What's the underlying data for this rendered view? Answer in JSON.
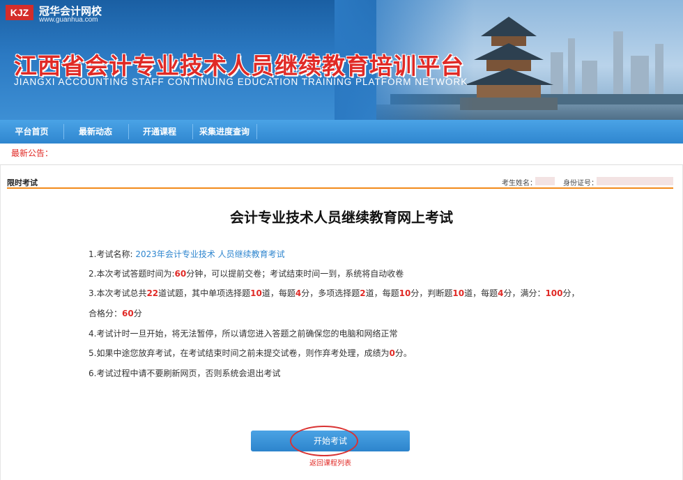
{
  "header": {
    "logo_mark": "KJZ",
    "logo_name": "冠华会计网校",
    "logo_url": "www.guanhua.com",
    "title_cn": "江西省会计专业技术人员继续教育培训平台",
    "title_en": "JIANGXI ACCOUNTING STAFF CONTINUING EDUCATION TRAINING PLATFORM NETWORK"
  },
  "nav": {
    "items": [
      {
        "label": "平台首页"
      },
      {
        "label": "最新动态"
      },
      {
        "label": "开通课程"
      },
      {
        "label": "采集进度查询"
      }
    ]
  },
  "notice": {
    "label": "最新公告："
  },
  "panel": {
    "heading": "限时考试",
    "examinee_label": "考生姓名：",
    "id_label": "身份证号："
  },
  "exam": {
    "title": "会计专业技术人员继续教育网上考试",
    "rule1_prefix": "1.考试名称:",
    "rule1_name": "2023年会计专业技术 人员继续教育考试",
    "rule2_a": "2.本次考试答题时间为:",
    "rule2_minutes": "60",
    "rule2_b": "分钟，可以提前交卷；考试结束时间一到，系统将自动收卷",
    "rule3_a": "3.本次考试总共",
    "rule3_total": "22",
    "rule3_b": "道试题，其中单项选择题",
    "rule3_single": "10",
    "rule3_c": "道，每题",
    "rule3_single_score": "4",
    "rule3_d": "分，多项选择题",
    "rule3_multi": "2",
    "rule3_e": "道，每题",
    "rule3_multi_score": "10",
    "rule3_f": "分，判断题",
    "rule3_judge": "10",
    "rule3_g": "道，每题",
    "rule3_judge_score": "4",
    "rule3_h": "分，满分：",
    "rule3_full": "100",
    "rule3_i": "分，",
    "rule3_pass_label": "合格分：",
    "rule3_pass": "60",
    "rule3_pass_unit": "分",
    "rule4": "4.考试计时一旦开始，将无法暂停，所以请您进入答题之前确保您的电脑和网络正常",
    "rule5_a": "5.如果中途您放弃考试，在考试结束时间之前未提交试卷，则作弃考处理，成绩为",
    "rule5_score": "0",
    "rule5_b": "分。",
    "rule6": "6.考试过程中请不要刷新网页，否则系统会退出考试",
    "start_button": "开始考试",
    "back_link": "返回课程列表"
  },
  "colors": {
    "accent_red": "#e02a26",
    "nav_blue": "#2f86cf",
    "divider_orange": "#f28a1a"
  }
}
